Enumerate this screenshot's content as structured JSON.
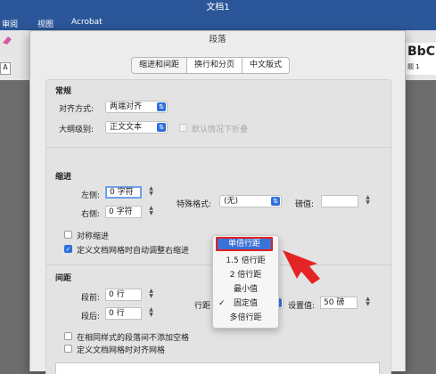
{
  "window": {
    "title": "文档1"
  },
  "menu": {
    "items": [
      "审阅",
      "视图",
      "Acrobat"
    ]
  },
  "ribbon": {
    "style_preview": "BbC",
    "style_name": "题 1"
  },
  "dialog": {
    "title": "段落",
    "tabs": [
      {
        "label": "缩进和间距",
        "active": true
      },
      {
        "label": "换行和分页",
        "active": false
      },
      {
        "label": "中文版式",
        "active": false
      }
    ],
    "general": {
      "heading": "常规",
      "alignment_label": "对齐方式:",
      "alignment_value": "两端对齐",
      "outline_label": "大纲级别:",
      "outline_value": "正文文本",
      "collapse_label": "默认情况下折叠"
    },
    "indent": {
      "heading": "缩进",
      "left_label": "左侧:",
      "left_value": "0 字符",
      "right_label": "右侧:",
      "right_value": "0 字符",
      "special_label": "特殊格式:",
      "special_value": "(无)",
      "by_label": "磅值:",
      "by_value": "",
      "mirror_label": "对称缩进",
      "auto_adjust_label": "定义文档网格时自动调整右缩进"
    },
    "spacing": {
      "heading": "间距",
      "before_label": "段前:",
      "before_value": "0 行",
      "after_label": "段后:",
      "after_value": "0 行",
      "line_label": "行距",
      "at_label": "设置值:",
      "at_value": "50 磅",
      "no_space_label": "在相同样式的段落间不添加空格",
      "snap_label": "定义文档网格时对齐网格"
    },
    "line_spacing_menu": {
      "options": [
        "单倍行距",
        "1.5 倍行距",
        "2 倍行距",
        "最小值",
        "固定值",
        "多倍行距"
      ],
      "highlighted": "单倍行距",
      "checked": "固定值",
      "checkmark": "✓"
    }
  },
  "colors": {
    "accent": "#2f6fdd",
    "highlight_border": "#e02020",
    "title_bar": "#2b579a"
  }
}
